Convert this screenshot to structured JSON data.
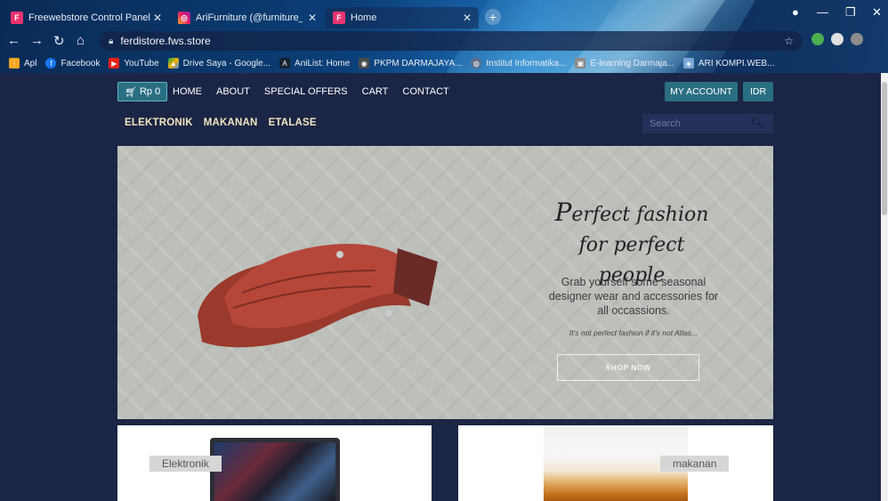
{
  "browser": {
    "tabs": [
      {
        "title": "Freewebstore Control Panel",
        "favicon": "freewebstore-icon"
      },
      {
        "title": "AriFurniture (@furniture_ari) • In",
        "favicon": "instagram-icon"
      },
      {
        "title": "Home",
        "favicon": "freewebstore-icon"
      }
    ],
    "url": "ferdistore.fws.store",
    "bookmarks": [
      {
        "label": "Apl",
        "icon": "apps-grid-icon"
      },
      {
        "label": "Facebook",
        "icon": "facebook-icon"
      },
      {
        "label": "YouTube",
        "icon": "youtube-icon"
      },
      {
        "label": "Drive Saya - Google...",
        "icon": "drive-icon"
      },
      {
        "label": "AniList: Home",
        "icon": "anilist-icon"
      },
      {
        "label": "PKPM DARMAJAYA...",
        "icon": "camera-icon"
      },
      {
        "label": "Institut Informatika...",
        "icon": "globe-icon"
      },
      {
        "label": "E-learning Darmaja...",
        "icon": "elearning-icon"
      },
      {
        "label": "ARI KOMPI.WEB...",
        "icon": "web-icon"
      }
    ]
  },
  "site": {
    "cart": {
      "label": "Rp 0",
      "icon": "cart-icon"
    },
    "nav": [
      "HOME",
      "ABOUT",
      "SPECIAL OFFERS",
      "CART",
      "CONTACT"
    ],
    "account_label": "MY ACCOUNT",
    "currency_label": "IDR",
    "categories": [
      "ELEKTRONIK",
      "MAKANAN",
      "ETALASE"
    ],
    "search": {
      "placeholder": "Search"
    },
    "hero": {
      "line1_cap": "P",
      "line1_rest": "erfect fashion",
      "line2": "for perfect people",
      "subtitle": "Grab yourself some seasonal designer wear and accessories for all occassions.",
      "small": "It's not perfect fashion if it's not Atlas...",
      "button": "SHOP NOW"
    },
    "cards": [
      {
        "label": "Elektronik"
      },
      {
        "label": "makanan"
      }
    ]
  },
  "colors": {
    "page_bg": "#1b2545",
    "accent": "#2a6f83",
    "category_text": "#f3e6c0"
  }
}
